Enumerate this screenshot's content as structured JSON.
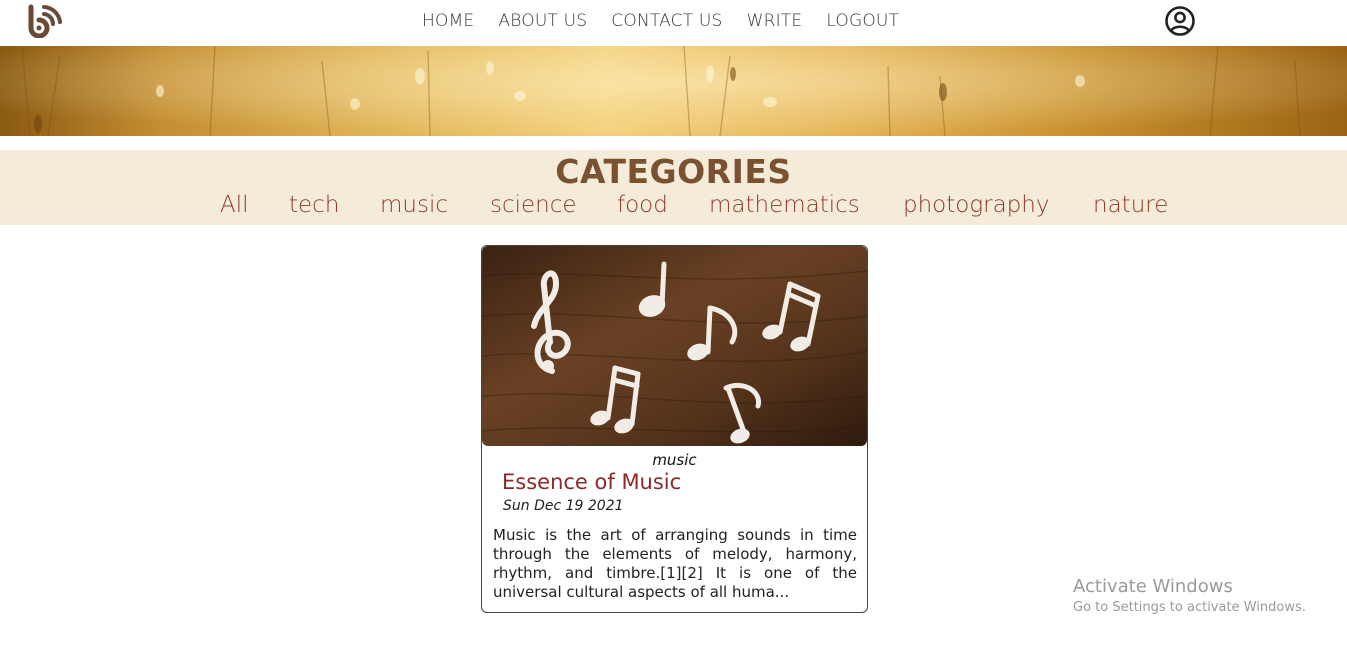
{
  "nav": {
    "items": [
      {
        "label": "HOME"
      },
      {
        "label": "ABOUT US"
      },
      {
        "label": "CONTACT US"
      },
      {
        "label": "WRITE"
      },
      {
        "label": "LOGOUT"
      }
    ]
  },
  "icons": {
    "logo": "blog-rss-logo-icon",
    "profile": "user-circle-icon"
  },
  "colors": {
    "brand_brown": "#7a5230",
    "category_bg": "#f5ebd9",
    "category_text": "#8a3a2a",
    "title_text": "#8a2a2a"
  },
  "categories": {
    "title": "CATEGORIES",
    "items": [
      "All",
      "tech",
      "music",
      "science",
      "food",
      "mathematics",
      "photography",
      "nature"
    ]
  },
  "post": {
    "category": "music",
    "title": "Essence of Music",
    "date": "Sun Dec 19 2021",
    "description": "Music is the art of arranging sounds in time through the elements of melody, harmony, rhythm, and timbre.[1][2] It is one of the universal cultural aspects of all huma..."
  },
  "watermark": {
    "title": "Activate Windows",
    "subtitle": "Go to Settings to activate Windows."
  }
}
